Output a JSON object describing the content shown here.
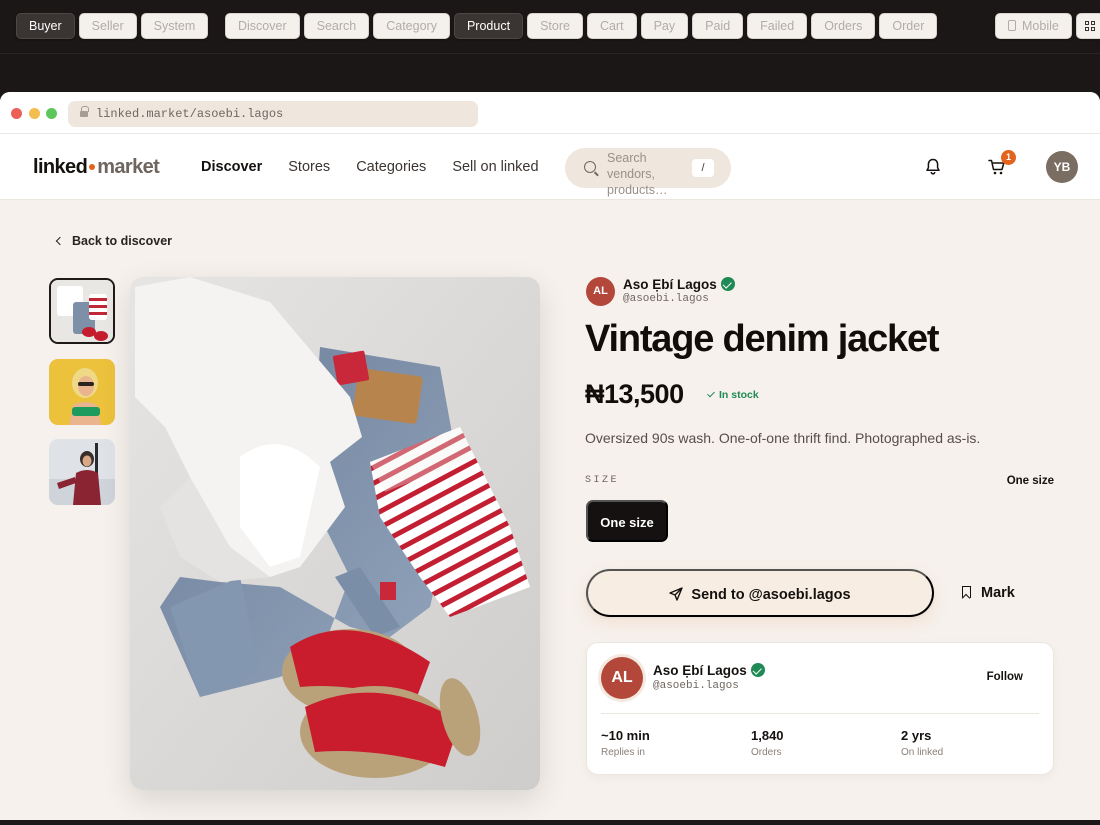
{
  "controls": {
    "mode_tabs": [
      {
        "label": "Buyer",
        "active": true
      },
      {
        "label": "Seller",
        "active": false
      },
      {
        "label": "System",
        "active": false
      }
    ],
    "screen_tabs": [
      {
        "label": "Discover",
        "active": false
      },
      {
        "label": "Search",
        "active": false
      },
      {
        "label": "Category",
        "active": false
      },
      {
        "label": "Product",
        "active": true
      },
      {
        "label": "Store",
        "active": false
      },
      {
        "label": "Cart",
        "active": false
      },
      {
        "label": "Pay",
        "active": false
      },
      {
        "label": "Paid",
        "active": false
      },
      {
        "label": "Failed",
        "active": false
      },
      {
        "label": "Orders",
        "active": false
      },
      {
        "label": "Order",
        "active": false
      }
    ],
    "device_label": "Mobile"
  },
  "browser": {
    "url": "linked.market/asoebi.lagos"
  },
  "header": {
    "logo_a": "linked",
    "logo_b": "market",
    "nav": [
      {
        "label": "Discover",
        "current": true
      },
      {
        "label": "Stores",
        "current": false
      },
      {
        "label": "Categories",
        "current": false
      },
      {
        "label": "Sell on linked",
        "current": false
      }
    ],
    "search_placeholder": "Search vendors, products…",
    "search_shortcut": "/",
    "cart_count": "1",
    "user_initials": "YB"
  },
  "page": {
    "back_label": "Back to discover",
    "store": {
      "initials": "AL",
      "name": "Aso Ẹbí Lagos",
      "handle": "@asoebi.lagos",
      "verified": true
    },
    "product": {
      "title": "Vintage denim jacket",
      "price": "₦13,500",
      "stock": "In stock",
      "description": "Oversized 90s wash. One-of-one thrift find. Photographed as-is.",
      "size_label": "SIZE",
      "size_selected": "One size",
      "size_option": "One size"
    },
    "actions": {
      "send": "Send to @asoebi.lagos",
      "mark": "Mark"
    },
    "store_card": {
      "initials": "AL",
      "name": "Aso Ẹbí Lagos",
      "handle": "@asoebi.lagos",
      "follow": "Follow",
      "stats": [
        {
          "value": "~10 min",
          "label": "Replies in"
        },
        {
          "value": "1,840",
          "label": "Orders"
        },
        {
          "value": "2 yrs",
          "label": "On linked"
        }
      ]
    }
  },
  "colors": {
    "accent": "#e2641d",
    "verified": "#1f8a55",
    "store_avatar": "#b3473a",
    "dark": "#151110"
  }
}
